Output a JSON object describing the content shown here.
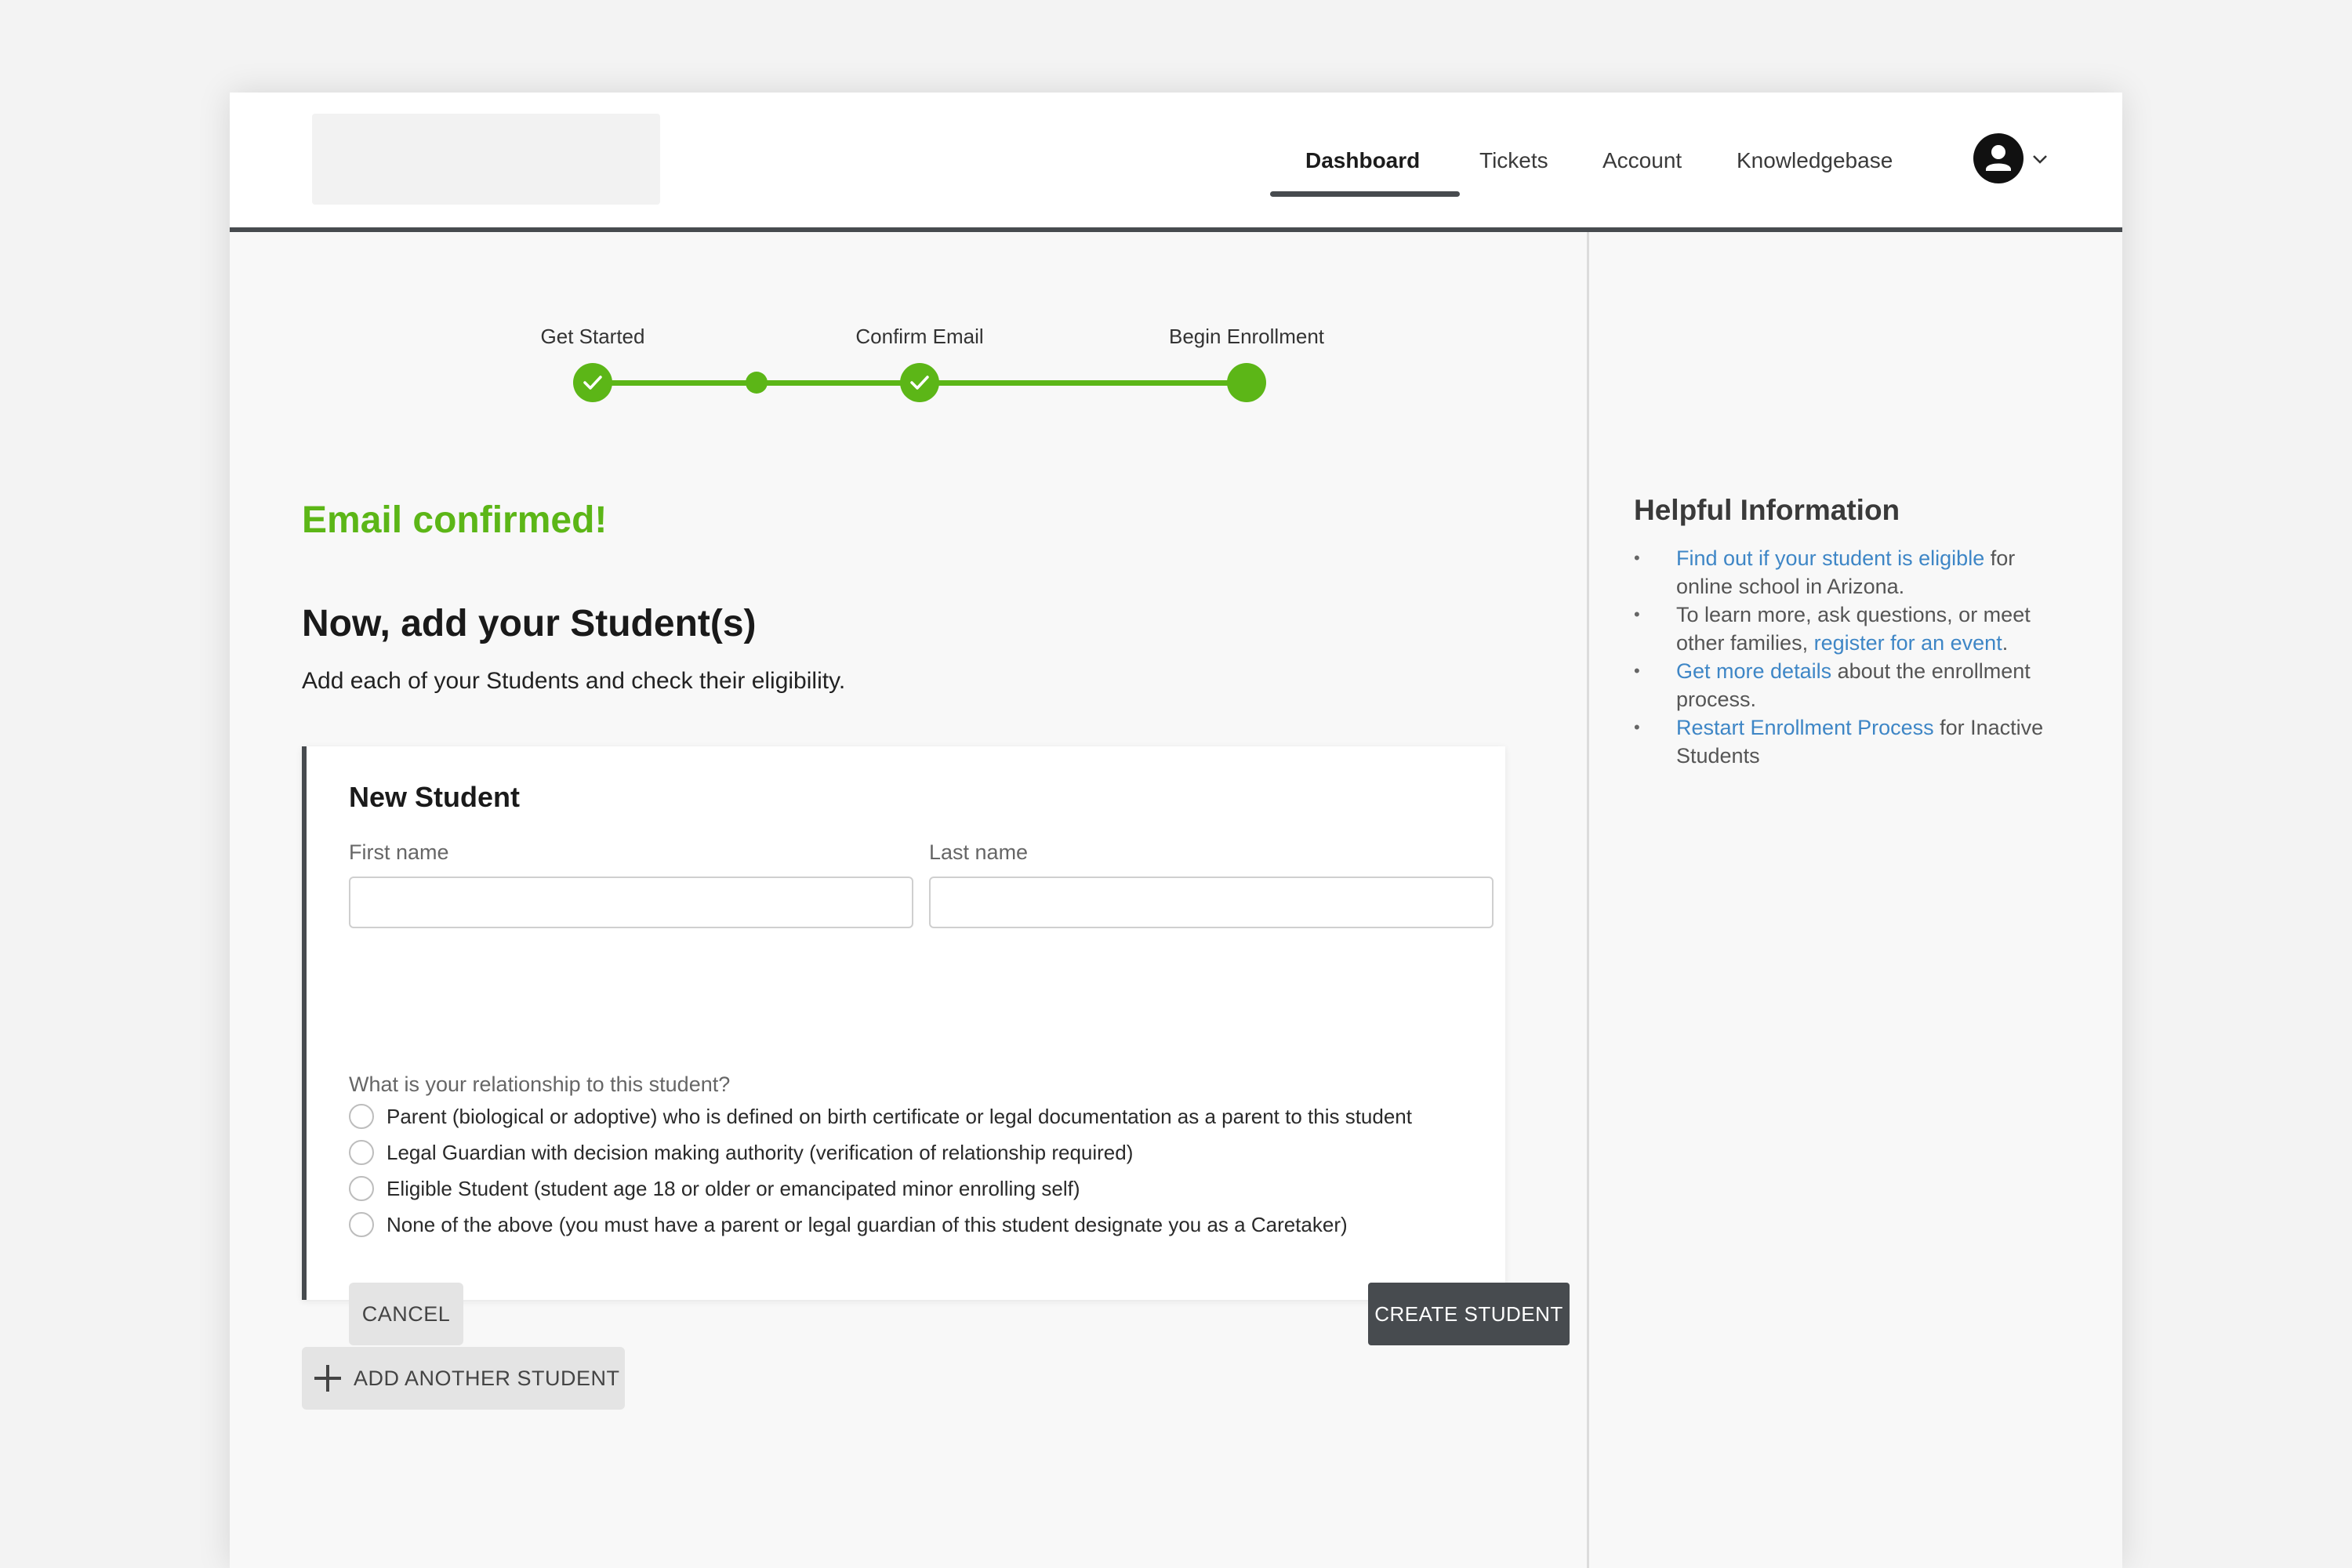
{
  "nav": {
    "items": [
      {
        "label": "Dashboard",
        "active": true
      },
      {
        "label": "Tickets",
        "active": false
      },
      {
        "label": "Account",
        "active": false
      },
      {
        "label": "Knowledgebase",
        "active": false
      }
    ],
    "avatar_icon": "user-icon",
    "chevron_icon": "chevron-down-icon"
  },
  "stepper": {
    "steps": [
      {
        "label": "Get Started",
        "state": "complete"
      },
      {
        "label": "Confirm Email",
        "state": "complete"
      },
      {
        "label": "Begin Enrollment",
        "state": "current"
      }
    ],
    "color": "#5cb617"
  },
  "main": {
    "status": "Email confirmed!",
    "title": "Now, add your Student(s)",
    "subtitle": "Add each of your Students and check their eligibility.",
    "card": {
      "title": "New Student",
      "first_name_label": "First name",
      "first_name_value": "",
      "last_name_label": "Last name",
      "last_name_value": "",
      "question": "What is your relationship to this student?",
      "options": [
        "Parent (biological or adoptive) who is defined on birth certificate or legal documentation as a parent to this student",
        "Legal Guardian with decision making authority (verification of relationship required)",
        "Eligible Student (student age 18 or older or emancipated minor enrolling self)",
        "None of the above (you must have a parent or legal guardian of this student designate you as a Caretaker)"
      ],
      "cancel_label": "CANCEL",
      "create_label": "CREATE STUDENT"
    },
    "add_another_label": "ADD ANOTHER STUDENT"
  },
  "sidebar": {
    "title": "Helpful Information",
    "items": [
      {
        "link": "Find out if your student is eligible",
        "after": " for online school in Arizona."
      },
      {
        "before": "To learn more, ask questions, or meet other families, ",
        "link": "register for an event",
        "after": "."
      },
      {
        "link": "Get more details",
        "after": " about the enrollment process."
      },
      {
        "link": "Restart Enrollment Process",
        "after": " for Inactive Students"
      }
    ]
  },
  "colors": {
    "accent_green": "#5cb617",
    "link_blue": "#3e86c6",
    "dark_gray": "#474b4f"
  }
}
